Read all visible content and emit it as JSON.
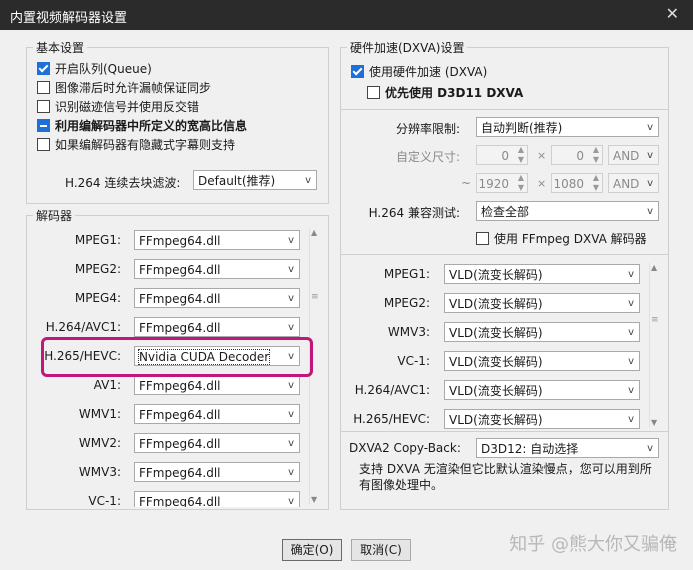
{
  "window": {
    "title": "内置视频解码器设置",
    "close_icon": "close-icon"
  },
  "basic": {
    "legend": "基本设置",
    "options": [
      {
        "label": "开启队列(Queue)",
        "state": "checked"
      },
      {
        "label": "图像滞后时允许漏帧保证同步",
        "state": "unchecked"
      },
      {
        "label": "识别磁迹信号并使用反交错",
        "state": "unchecked"
      },
      {
        "label": "利用编解码器中所定义的宽高比信息",
        "state": "indeterminate"
      },
      {
        "label": "如果编解码器有隐藏式字幕则支持",
        "state": "unchecked"
      }
    ],
    "deblock_label": "H.264 连续去块滤波:",
    "deblock_value": "Default(推荐)"
  },
  "decoders": {
    "legend": "解码器",
    "rows": [
      {
        "label": "MPEG1:",
        "value": "FFmpeg64.dll"
      },
      {
        "label": "MPEG2:",
        "value": "FFmpeg64.dll"
      },
      {
        "label": "MPEG4:",
        "value": "FFmpeg64.dll"
      },
      {
        "label": "H.264/AVC1:",
        "value": "FFmpeg64.dll"
      },
      {
        "label": "H.265/HEVC:",
        "value": "Nvidia CUDA Decoder"
      },
      {
        "label": "AV1:",
        "value": "FFmpeg64.dll"
      },
      {
        "label": "WMV1:",
        "value": "FFmpeg64.dll"
      },
      {
        "label": "WMV2:",
        "value": "FFmpeg64.dll"
      },
      {
        "label": "WMV3:",
        "value": "FFmpeg64.dll"
      },
      {
        "label": "VC-1:",
        "value": "FFmpeg64.dll"
      }
    ]
  },
  "hw": {
    "legend": "硬件加速(DXVA)设置",
    "use_hw": "使用硬件加速 (DXVA)",
    "prefer_d3d11": "优先使用 D3D11 DXVA",
    "res_label": "分辨率限制:",
    "res_value": "自动判断(推荐)",
    "custom_label": "自定义尺寸:",
    "min_w": "0",
    "min_h": "0",
    "min_and": "AND",
    "tilde": "~",
    "max_w": "1920",
    "max_h": "1080",
    "max_and": "AND",
    "times": "×",
    "compat_label": "H.264 兼容测试:",
    "compat_value": "检查全部",
    "ffmpeg_dxva": "使用 FFmpeg DXVA 解码器",
    "rows": [
      {
        "label": "MPEG1:",
        "value": "VLD(流变长解码)"
      },
      {
        "label": "MPEG2:",
        "value": "VLD(流变长解码)"
      },
      {
        "label": "WMV3:",
        "value": "VLD(流变长解码)"
      },
      {
        "label": "VC-1:",
        "value": "VLD(流变长解码)"
      },
      {
        "label": "H.264/AVC1:",
        "value": "VLD(流变长解码)"
      },
      {
        "label": "H.265/HEVC:",
        "value": "VLD(流变长解码)"
      }
    ],
    "copyback_label": "DXVA2 Copy-Back:",
    "copyback_value": "D3D12: 自动选择",
    "note": "支持 DXVA 无渲染但它比默认渲染慢点，您可以用到所有图像处理中。"
  },
  "buttons": {
    "ok": "确定(O)",
    "cancel": "取消(C)"
  },
  "watermark": "知乎 @熊大你又骗俺",
  "colors": {
    "checkbox_accent": "#1e6fd9",
    "highlight": "#c0177d",
    "titlebar": "#2b2b2b"
  }
}
